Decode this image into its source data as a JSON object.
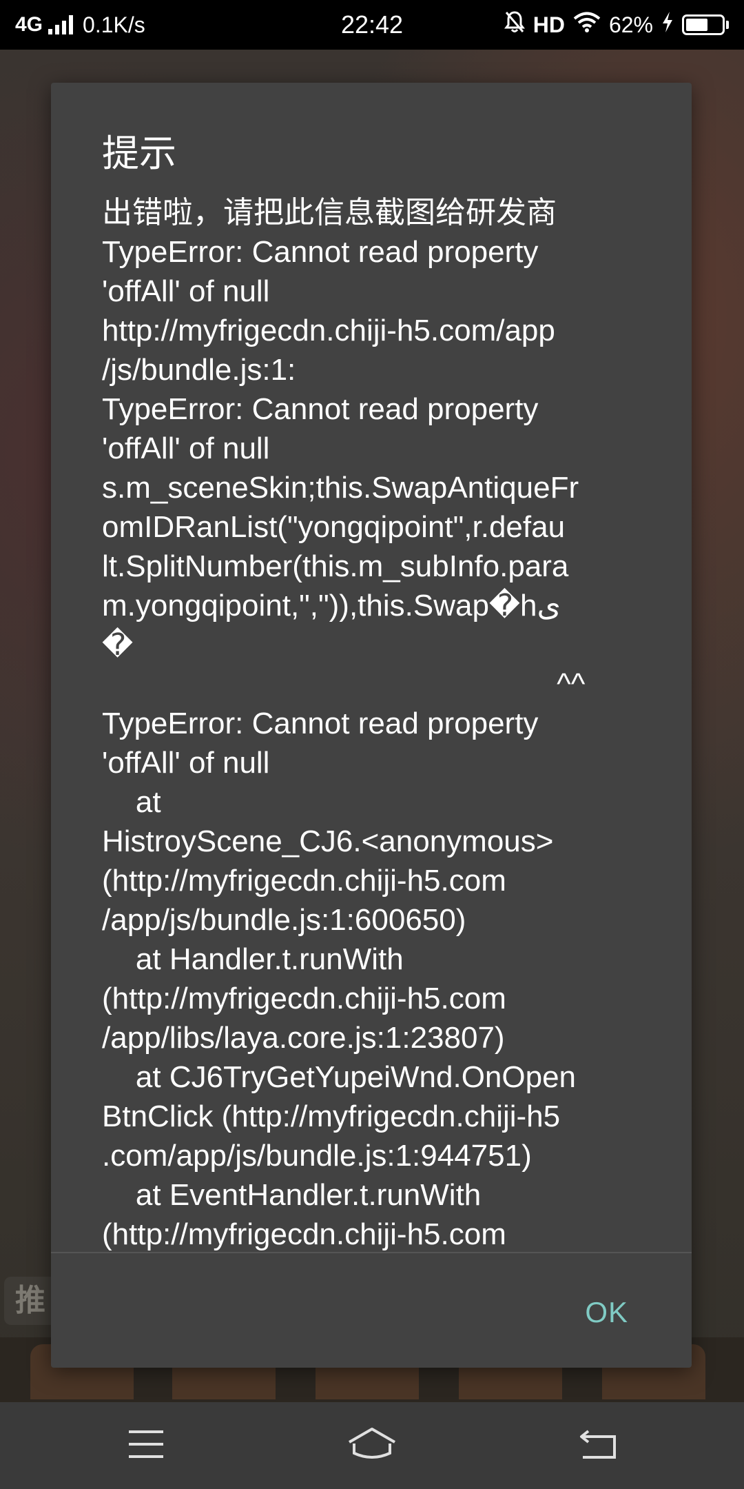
{
  "status_bar": {
    "network": "4G",
    "speed": "0.1K/s",
    "time": "22:42",
    "hd_label": "HD",
    "battery_percent": "62%",
    "battery_level": 0.62
  },
  "dialog": {
    "title": "提示",
    "message_lines": [
      "出错啦，请把此信息截图给研发商",
      "TypeError: Cannot read property",
      "'offAll' of null",
      "http://myfrigecdn.chiji-h5.com/app",
      "/js/bundle.js:1:",
      "TypeError: Cannot read property",
      "'offAll' of null",
      "s.m_sceneSkin;this.SwapAntiqueFr",
      "omIDRanList(\"yongqipoint\",r.defau",
      "lt.SplitNumber(this.m_subInfo.para",
      "m.yongqipoint,\",\")),this.Swap�hى",
      "�",
      "                                                      ^^",
      "TypeError: Cannot read property",
      "'offAll' of null",
      "    at",
      "HistroyScene_CJ6.<anonymous>",
      "(http://myfrigecdn.chiji-h5.com",
      "/app/js/bundle.js:1:600650)",
      "    at Handler.t.runWith",
      "(http://myfrigecdn.chiji-h5.com",
      "/app/libs/laya.core.js:1:23807)",
      "    at CJ6TryGetYupeiWnd.OnOpen",
      "BtnClick (http://myfrigecdn.chiji-h5",
      ".com/app/js/bundle.js:1:944751)",
      "    at EventHandler.t.runWith",
      "(http://myfrigecdn.chiji-h5.com"
    ],
    "ok_label": "OK"
  },
  "background": {
    "partial_badge_text": "推"
  },
  "colors": {
    "status_bar_bg": "#000000",
    "dialog_bg": "#424242",
    "ok_accent": "#80cbc4",
    "nav_bar_bg": "#3a3a3a"
  },
  "icons": {
    "signal": "signal-bars-icon",
    "mute": "bell-off-icon",
    "wifi": "wifi-icon",
    "charging": "lightning-icon",
    "battery": "battery-icon",
    "menu": "menu-icon",
    "home": "home-icon",
    "back": "back-icon"
  }
}
